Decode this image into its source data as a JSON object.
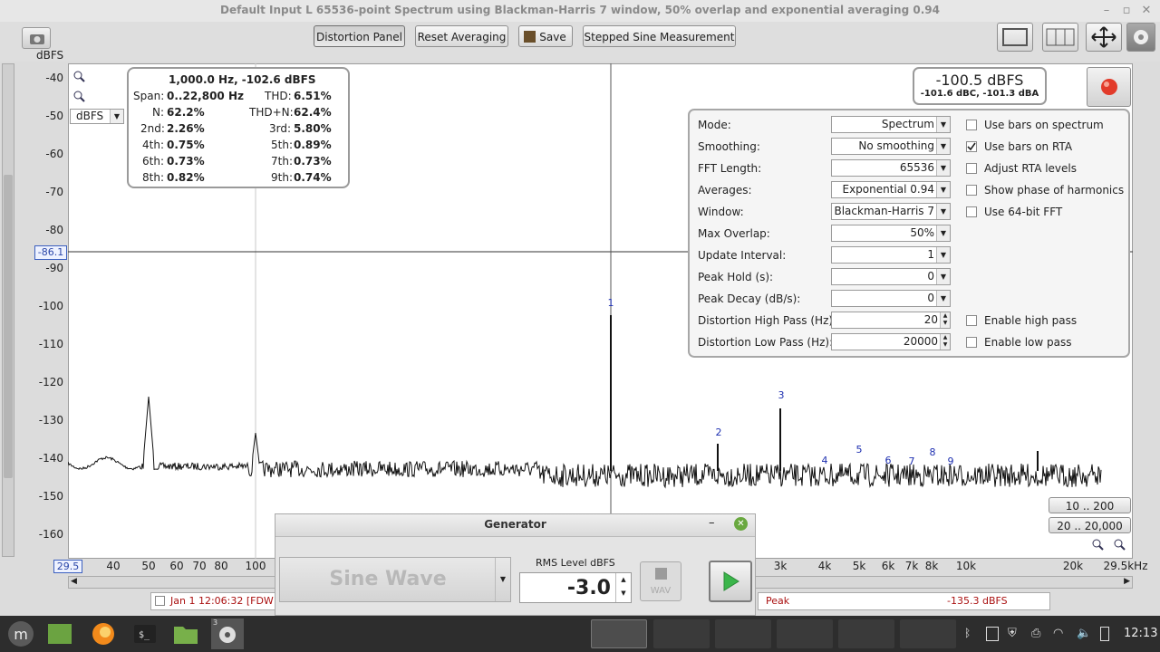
{
  "window": {
    "title": "Default Input L 65536-point Spectrum using Blackman-Harris 7 window, 50% overlap and exponential averaging 0.94"
  },
  "toolbar": {
    "distortion_panel": "Distortion Panel",
    "reset_averaging": "Reset Averaging",
    "save": "Save",
    "stepped_sine": "Stepped Sine Measurement"
  },
  "axis": {
    "y_unit": "dBFS",
    "y_ticks": [
      "-40",
      "-50",
      "-60",
      "-70",
      "-80",
      "-90",
      "-100",
      "-110",
      "-120",
      "-130",
      "-140",
      "-150",
      "-160"
    ],
    "x_ticks": [
      "40",
      "50",
      "60",
      "70",
      "80",
      "100",
      "3k",
      "4k",
      "5k",
      "6k",
      "7k",
      "8k",
      "10k",
      "20k",
      "29.5kHz"
    ],
    "x_start": "29.5",
    "cursor_level": "-86.1",
    "unit_select": "dBFS"
  },
  "stats": {
    "header": "1,000.0 Hz, -102.6 dBFS",
    "span_label": "Span:",
    "span": "0..22,800 Hz",
    "thd_label": "THD:",
    "thd": "6.51%",
    "n_label": "N:",
    "n": "62.2%",
    "thdn_label": "THD+N:",
    "thdn": "62.4%",
    "h2_label": "2nd:",
    "h2": "2.26%",
    "h3_label": "3rd:",
    "h3": "5.80%",
    "h4_label": "4th:",
    "h4": "0.75%",
    "h5_label": "5th:",
    "h5": "0.89%",
    "h6_label": "6th:",
    "h6": "0.73%",
    "h7_label": "7th:",
    "h7": "0.73%",
    "h8_label": "8th:",
    "h8": "0.82%",
    "h9_label": "9th:",
    "h9": "0.74%"
  },
  "level": {
    "main": "-100.5 dBFS",
    "sub": "-101.6 dBC, -101.3 dBA"
  },
  "panel": {
    "mode_label": "Mode:",
    "mode": "Spectrum",
    "smoothing_label": "Smoothing:",
    "smoothing": "No smoothing",
    "fft_label": "FFT Length:",
    "fft": "65536",
    "averages_label": "Averages:",
    "averages": "Exponential 0.94",
    "window_label": "Window:",
    "window": "Blackman-Harris 7",
    "overlap_label": "Max Overlap:",
    "overlap": "50%",
    "update_label": "Update Interval:",
    "update": "1",
    "peakhold_label": "Peak Hold (s):",
    "peakhold": "0",
    "peakdecay_label": "Peak Decay (dB/s):",
    "peakdecay": "0",
    "hp_label": "Distortion High Pass (Hz):",
    "hp": "20",
    "lp_label": "Distortion Low Pass (Hz):",
    "lp": "20000",
    "cb_bars_spectrum": "Use bars on spectrum",
    "cb_bars_rta": "Use bars on RTA",
    "cb_adjust_rta": "Adjust RTA levels",
    "cb_phase": "Show phase of harmonics",
    "cb_64bit": "Use 64-bit FFT",
    "cb_high_pass": "Enable high pass",
    "cb_low_pass": "Enable low pass"
  },
  "range_buttons": {
    "r1": "10 .. 200",
    "r2": "20 .. 20,000"
  },
  "harmonic_markers": [
    "1",
    "2",
    "3",
    "4",
    "5",
    "6",
    "7",
    "8",
    "9"
  ],
  "generator": {
    "title": "Generator",
    "waveform": "Sine Wave",
    "rms_label": "RMS Level dBFS",
    "rms_value": "-3.0",
    "wav_label": "WAV"
  },
  "status": {
    "left": "Jan 1 12:06:32 [FDW",
    "peak_label": "Peak",
    "peak_value": "-135.3 dBFS"
  },
  "taskbar": {
    "clock": "12:13",
    "badge": "3"
  }
}
